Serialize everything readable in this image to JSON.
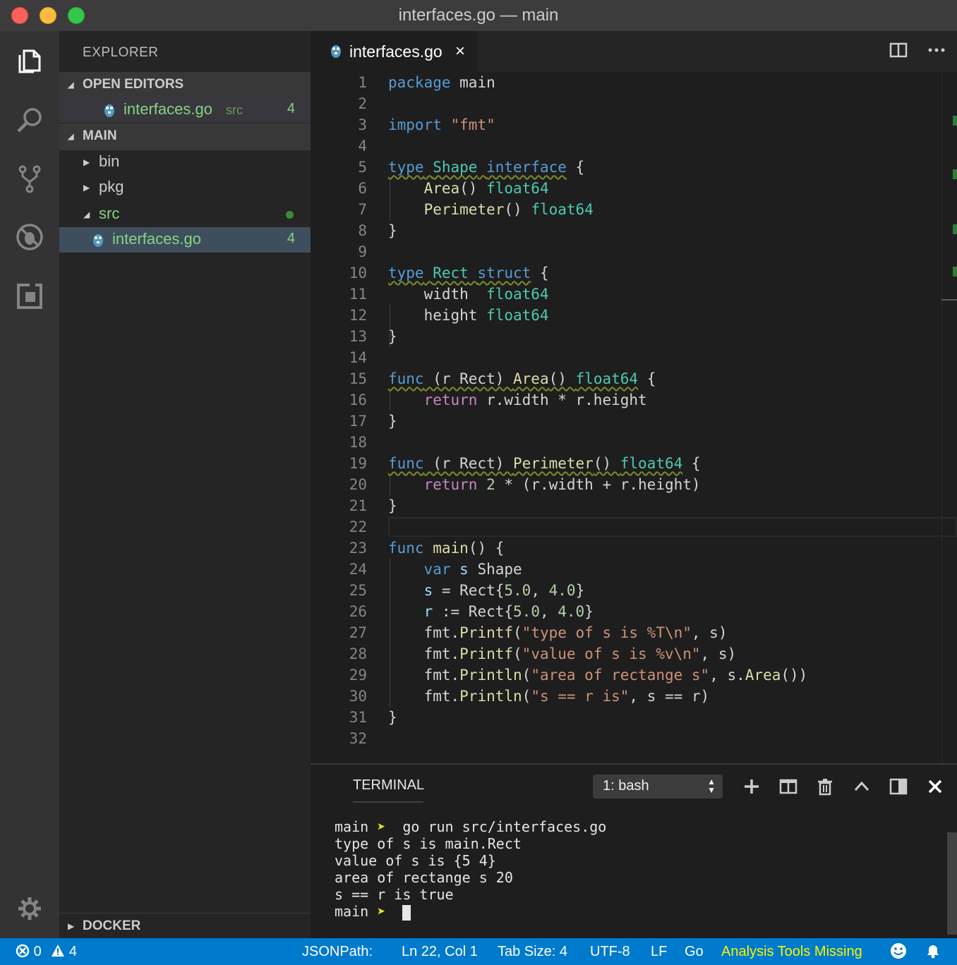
{
  "window": {
    "title": "interfaces.go — main"
  },
  "activity_bar": {
    "items": [
      {
        "name": "explorer-icon"
      },
      {
        "name": "search-icon"
      },
      {
        "name": "source-control-icon"
      },
      {
        "name": "debug-icon"
      },
      {
        "name": "extensions-icon"
      }
    ],
    "settings": "gear-icon"
  },
  "sidebar": {
    "title": "EXPLORER",
    "open_editors": {
      "label": "OPEN EDITORS",
      "file": "interfaces.go",
      "folder": "src",
      "problems": "4"
    },
    "main": {
      "label": "MAIN",
      "items": [
        {
          "label": "bin"
        },
        {
          "label": "pkg"
        },
        {
          "label": "src"
        }
      ],
      "file": "interfaces.go",
      "file_problems": "4"
    },
    "docker": "DOCKER"
  },
  "editor": {
    "tab": "interfaces.go",
    "tab_close": "×",
    "line_numbers": [
      "1",
      "2",
      "3",
      "4",
      "5",
      "6",
      "7",
      "8",
      "9",
      "10",
      "11",
      "12",
      "13",
      "14",
      "15",
      "16",
      "17",
      "18",
      "19",
      "20",
      "21",
      "22",
      "23",
      "24",
      "25",
      "26",
      "27",
      "28",
      "29",
      "30",
      "31",
      "32"
    ]
  },
  "terminal": {
    "title": "TERMINAL",
    "selector": "1: bash",
    "lines": {
      "l1_prompt": "main",
      "l1_arrow": "➤",
      "l1_cmd": "  go run src/interfaces.go",
      "l2": "type of s is main.Rect",
      "l3": "value of s is {5 4}",
      "l4": "area of rectange s 20",
      "l5": "s == r is true",
      "l6_prompt": "main",
      "l6_arrow": "➤"
    }
  },
  "status_bar": {
    "errors": "0",
    "warnings": "4",
    "jsonpath": "JSONPath:",
    "position": "Ln 22, Col 1",
    "tab_size": "Tab Size: 4",
    "encoding": "UTF-8",
    "eol": "LF",
    "language": "Go",
    "analysis": "Analysis Tools Missing"
  },
  "colors": {
    "accent": "#007acc",
    "keyword": "#569cd6",
    "type": "#4ec9b0",
    "function": "#dcdcaa",
    "string": "#ce9178",
    "number": "#b5cea8",
    "control": "#c586c0",
    "warning_text": "#f6f600"
  }
}
